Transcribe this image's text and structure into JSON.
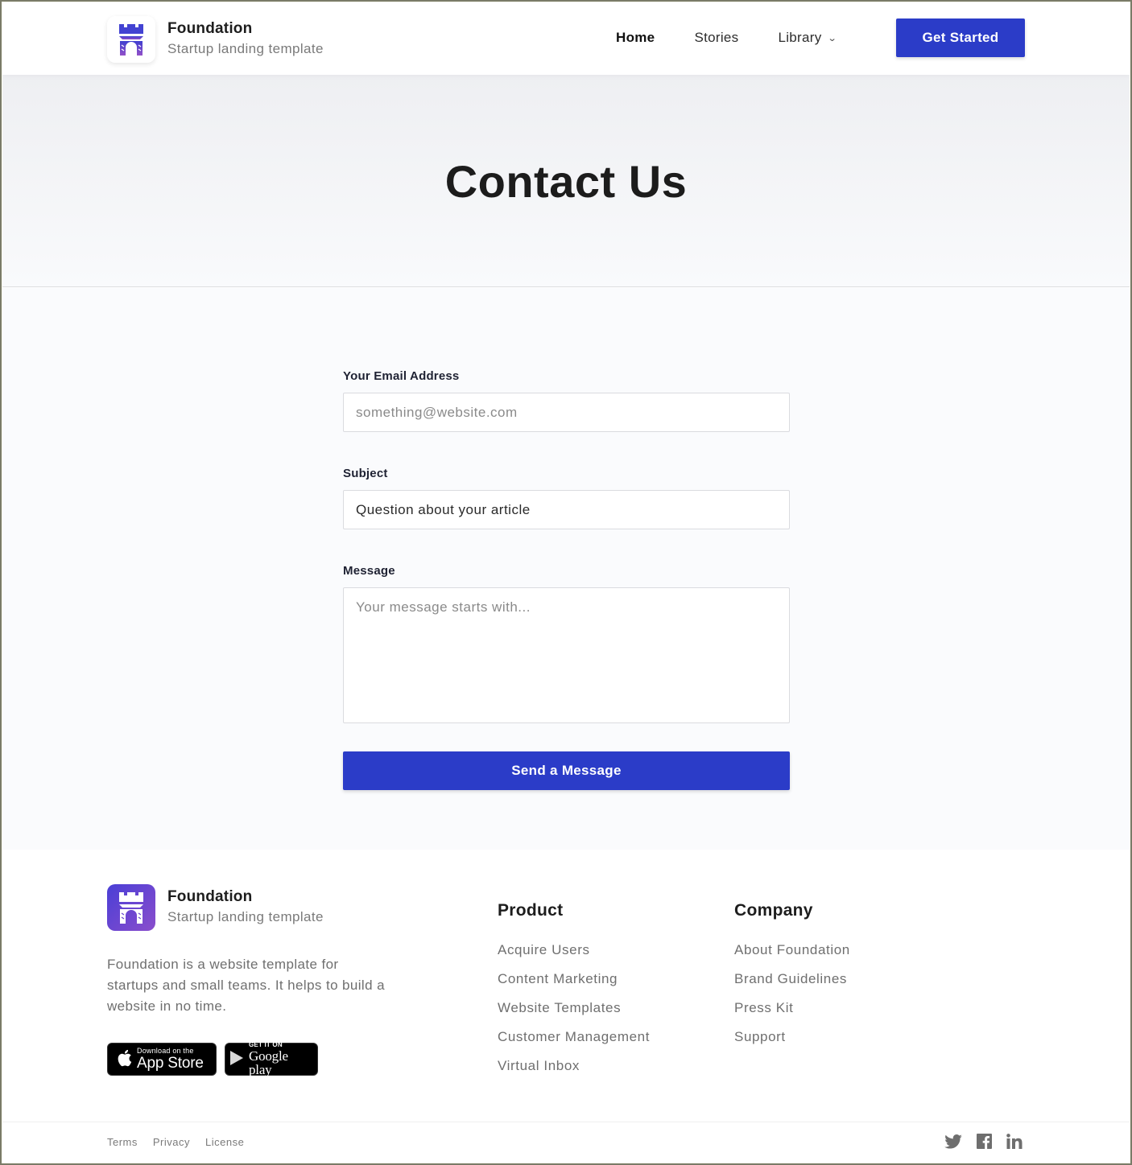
{
  "header": {
    "brand_name": "Foundation",
    "brand_tagline": "Startup landing template",
    "nav": [
      {
        "label": "Home",
        "active": true
      },
      {
        "label": "Stories",
        "active": false
      },
      {
        "label": "Library",
        "active": false,
        "has_dropdown": true
      }
    ],
    "cta_label": "Get Started"
  },
  "hero": {
    "title": "Contact Us"
  },
  "form": {
    "email": {
      "label": "Your Email Address",
      "placeholder": "something@website.com",
      "value": ""
    },
    "subject": {
      "label": "Subject",
      "placeholder": "",
      "value": "Question about your article"
    },
    "message": {
      "label": "Message",
      "placeholder": "Your message starts with...",
      "value": ""
    },
    "submit_label": "Send a Message"
  },
  "footer": {
    "brand_name": "Foundation",
    "brand_tagline": "Startup landing template",
    "description": "Foundation is a website template for startups and small teams. It helps to build a website in no time.",
    "badges": {
      "apple": {
        "small": "Download on the",
        "big": "App Store"
      },
      "google": {
        "small": "GET IT ON",
        "big": "Google play"
      }
    },
    "columns": [
      {
        "title": "Product",
        "links": [
          "Acquire Users",
          "Content Marketing",
          "Website Templates",
          "Customer Management",
          "Virtual Inbox"
        ]
      },
      {
        "title": "Company",
        "links": [
          "About Foundation",
          "Brand Guidelines",
          "Press Kit",
          "Support"
        ]
      }
    ],
    "legal": [
      "Terms",
      "Privacy",
      "License"
    ],
    "social": [
      "twitter-icon",
      "facebook-icon",
      "linkedin-icon"
    ]
  },
  "colors": {
    "accent": "#2b3cc8",
    "logo_gradient_start": "#4a3fd6",
    "logo_gradient_end": "#8a4dcc"
  }
}
